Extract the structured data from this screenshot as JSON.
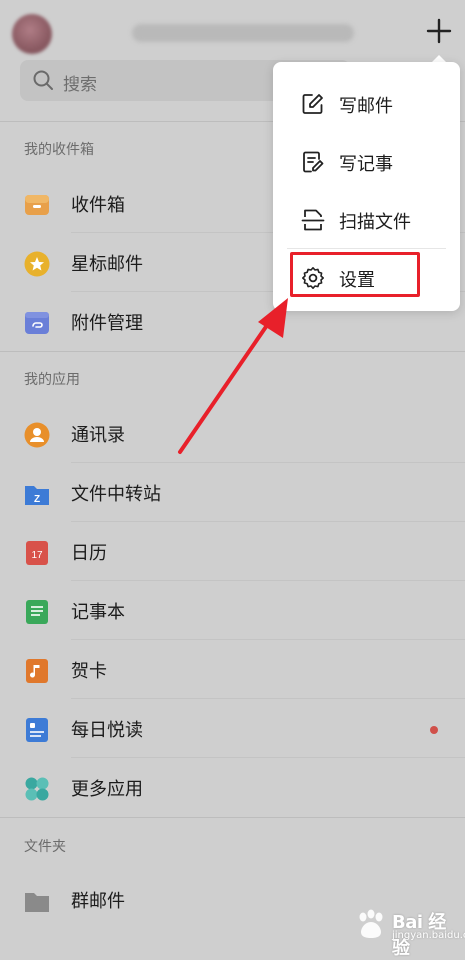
{
  "header": {
    "account_text": "",
    "add_icon": "plus-icon"
  },
  "search": {
    "placeholder": "搜索",
    "icon": "search-icon"
  },
  "sections": {
    "inbox_title": "我的收件箱",
    "apps_title": "我的应用",
    "folders_title": "文件夹"
  },
  "inbox_items": [
    {
      "label": "收件箱",
      "icon": "inbox-icon",
      "color": "#e8a04a"
    },
    {
      "label": "星标邮件",
      "icon": "star-icon",
      "color": "#e8b12c"
    },
    {
      "label": "附件管理",
      "icon": "attachment-icon",
      "color": "#6a7fd8"
    }
  ],
  "app_items": [
    {
      "label": "通讯录",
      "icon": "contacts-icon",
      "color": "#e88f2a"
    },
    {
      "label": "文件中转站",
      "icon": "file-transfer-icon",
      "color": "#3d7bd6"
    },
    {
      "label": "日历",
      "icon": "calendar-icon",
      "color": "#d8524a",
      "badge_text": "17"
    },
    {
      "label": "记事本",
      "icon": "notebook-icon",
      "color": "#3aa85a"
    },
    {
      "label": "贺卡",
      "icon": "greeting-card-icon",
      "color": "#e0782c"
    },
    {
      "label": "每日悦读",
      "icon": "daily-reading-icon",
      "color": "#3d7bd6"
    },
    {
      "label": "更多应用",
      "icon": "more-apps-icon",
      "color": "#3aa8a0"
    }
  ],
  "folder_items": [
    {
      "label": "群邮件",
      "icon": "folder-icon",
      "color": "#8a8a8a"
    }
  ],
  "dropdown_menu": {
    "items": [
      {
        "label": "写邮件",
        "icon": "compose-icon"
      },
      {
        "label": "写记事",
        "icon": "write-note-icon"
      },
      {
        "label": "扫描文件",
        "icon": "scan-icon"
      },
      {
        "label": "设置",
        "icon": "settings-gear-icon"
      }
    ]
  },
  "annotation": {
    "highlight_color": "#e8202a"
  },
  "watermark": {
    "logo_text": "Bai 经验",
    "sub_text": "jingyan.baidu.com"
  }
}
